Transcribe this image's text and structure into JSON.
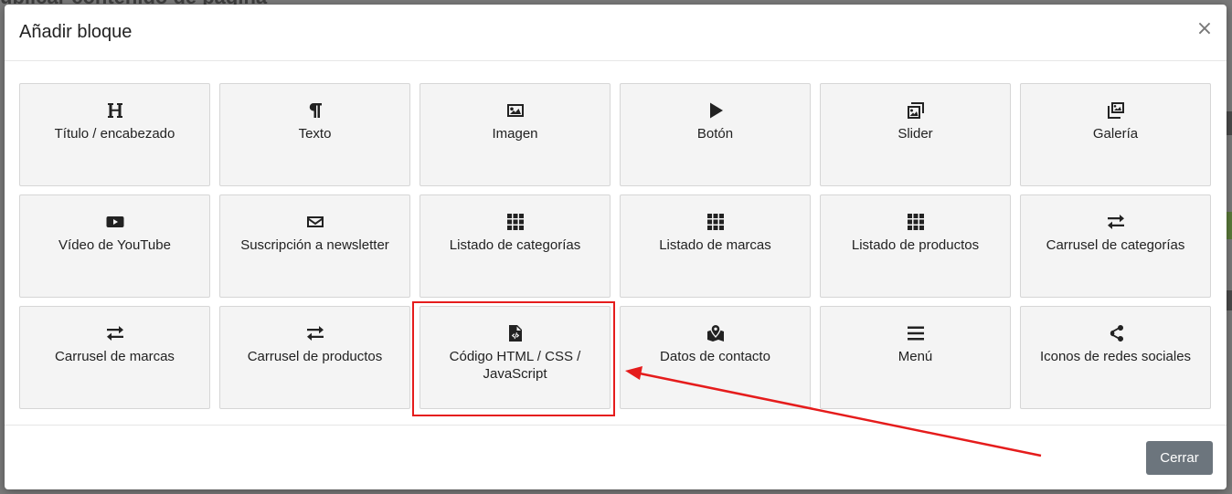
{
  "background": {
    "heading": "ublicar contenido de página"
  },
  "modal": {
    "title": "Añadir bloque",
    "close_symbol": "×",
    "footer_button": "Cerrar"
  },
  "blocks": [
    {
      "label": "Título / encabezado",
      "icon": "heading-icon"
    },
    {
      "label": "Texto",
      "icon": "paragraph-icon"
    },
    {
      "label": "Imagen",
      "icon": "image-icon"
    },
    {
      "label": "Botón",
      "icon": "play-icon"
    },
    {
      "label": "Slider",
      "icon": "images-icon"
    },
    {
      "label": "Galería",
      "icon": "gallery-icon"
    },
    {
      "label": "Vídeo de YouTube",
      "icon": "youtube-icon"
    },
    {
      "label": "Suscripción a newsletter",
      "icon": "envelope-icon"
    },
    {
      "label": "Listado de categorías",
      "icon": "grid-icon"
    },
    {
      "label": "Listado de marcas",
      "icon": "grid-icon"
    },
    {
      "label": "Listado de productos",
      "icon": "grid-icon"
    },
    {
      "label": "Carrusel de categorías",
      "icon": "exchange-icon"
    },
    {
      "label": "Carrusel de marcas",
      "icon": "exchange-icon"
    },
    {
      "label": "Carrusel de productos",
      "icon": "exchange-icon"
    },
    {
      "label": "Código HTML / CSS / JavaScript",
      "icon": "file-code-icon"
    },
    {
      "label": "Datos de contacto",
      "icon": "map-marked-icon"
    },
    {
      "label": "Menú",
      "icon": "bars-icon"
    },
    {
      "label": "Iconos de redes sociales",
      "icon": "share-icon"
    }
  ],
  "annotation": {
    "color": "#e51c1c",
    "highlighted_block": "Código HTML / CSS / JavaScript"
  }
}
